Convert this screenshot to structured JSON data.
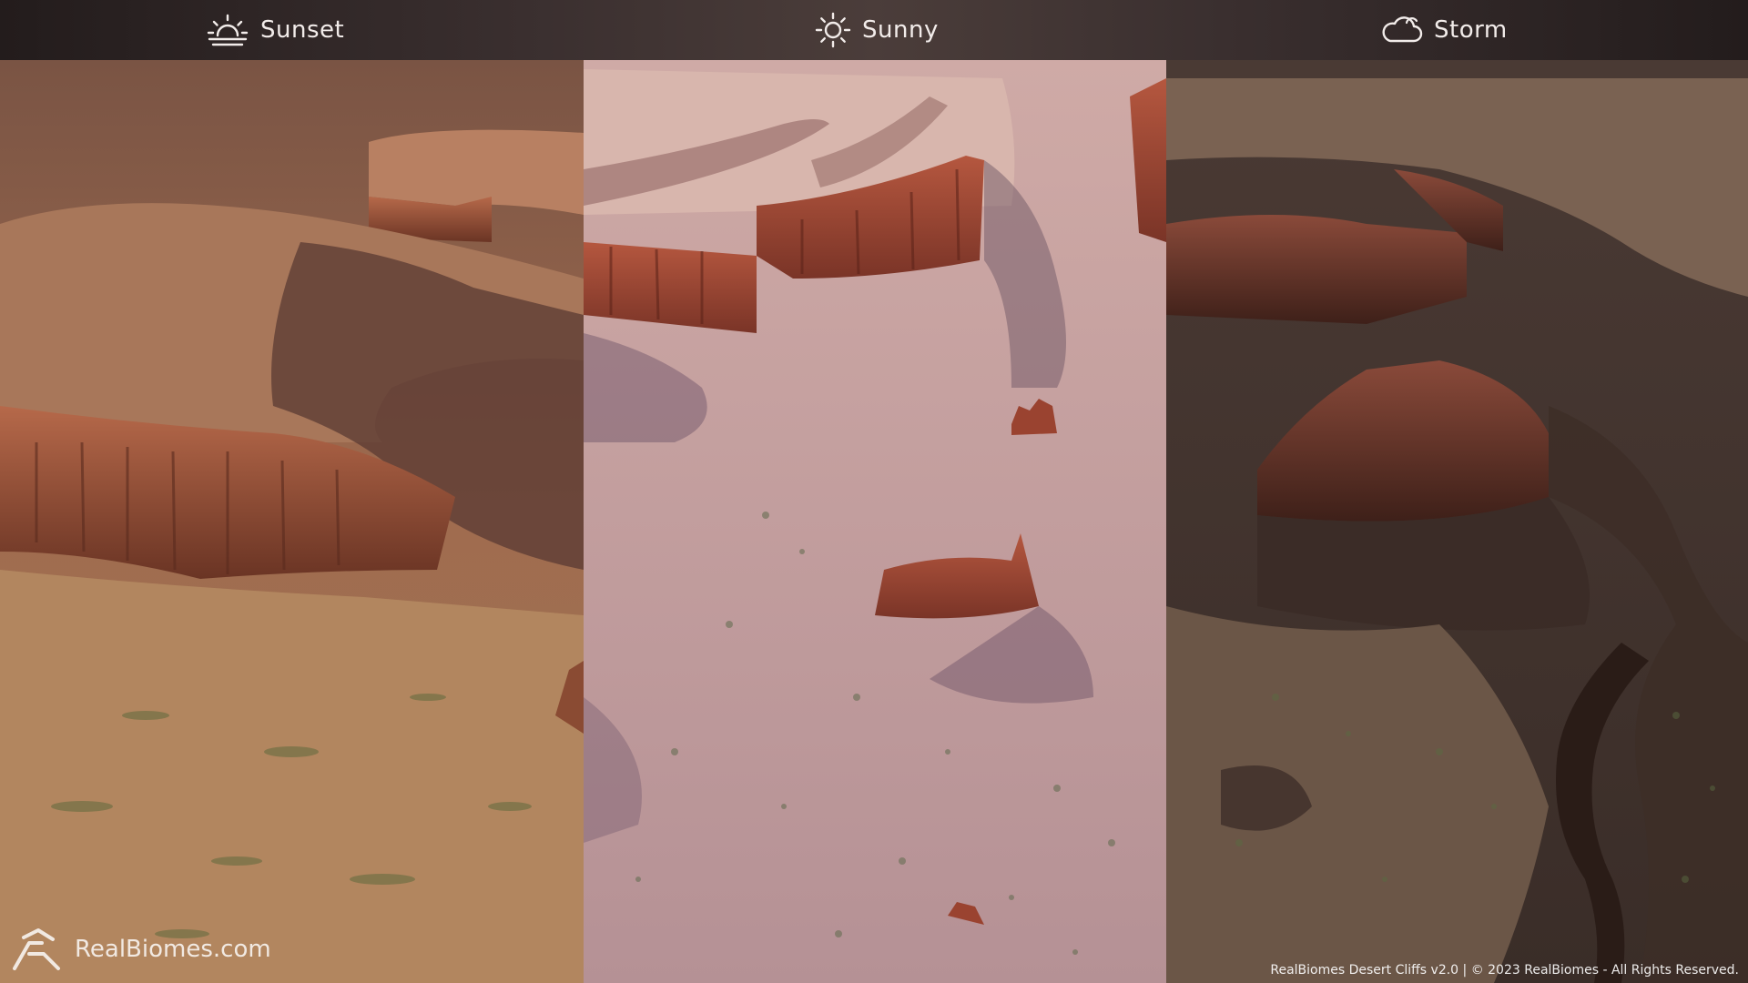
{
  "tabs": [
    {
      "label": "Sunset",
      "icon": "sunset-icon"
    },
    {
      "label": "Sunny",
      "icon": "sun-icon"
    },
    {
      "label": "Storm",
      "icon": "cloud-icon"
    }
  ],
  "branding": {
    "logo_text": "RealBiomes.com",
    "copyright": "RealBiomes Desert Cliffs v2.0 | © 2023 RealBiomes - All Rights Reserved."
  },
  "colors": {
    "header_bg": "#3a2f2f",
    "header_text": "#f2ecea",
    "sunset_ground": "#a46e4e",
    "sunny_ground": "#c9a5a6",
    "storm_ground": "#5a4338"
  }
}
